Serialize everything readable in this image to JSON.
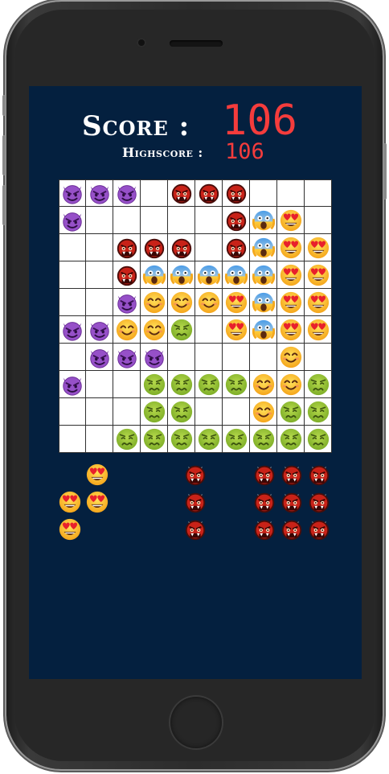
{
  "score": {
    "label": "Score :",
    "value": "106"
  },
  "highscore": {
    "label": "Highscore :",
    "value": "106"
  },
  "legend": {
    "D": "devil-emoji",
    "O": "ogre-emoji",
    "S": "scream-emoji",
    "H": "heart-eyes-emoji",
    "Y": "smiley-emoji",
    "G": "nauseated-emoji",
    ".": "empty"
  },
  "board": [
    "DDD.OOO...",
    "D.....OSH.",
    "..OOO.OSHH",
    "..OSSSSSHH",
    "..DYYYHSHH",
    "DDYYG.HSHH",
    ".DDD....Y.",
    "D..GGGGYYG",
    "...GG..YGG",
    "..GGGGGGGG"
  ],
  "pieces": [
    {
      "name": "piece-heart-eyes",
      "rows": [
        ".H.",
        "HH.",
        "H.."
      ]
    },
    {
      "name": "piece-ogre-line",
      "rows": [
        ".O.",
        ".O.",
        ".O."
      ]
    },
    {
      "name": "piece-ogre-square",
      "rows": [
        "OOO",
        "OOO",
        "OOO"
      ]
    }
  ]
}
